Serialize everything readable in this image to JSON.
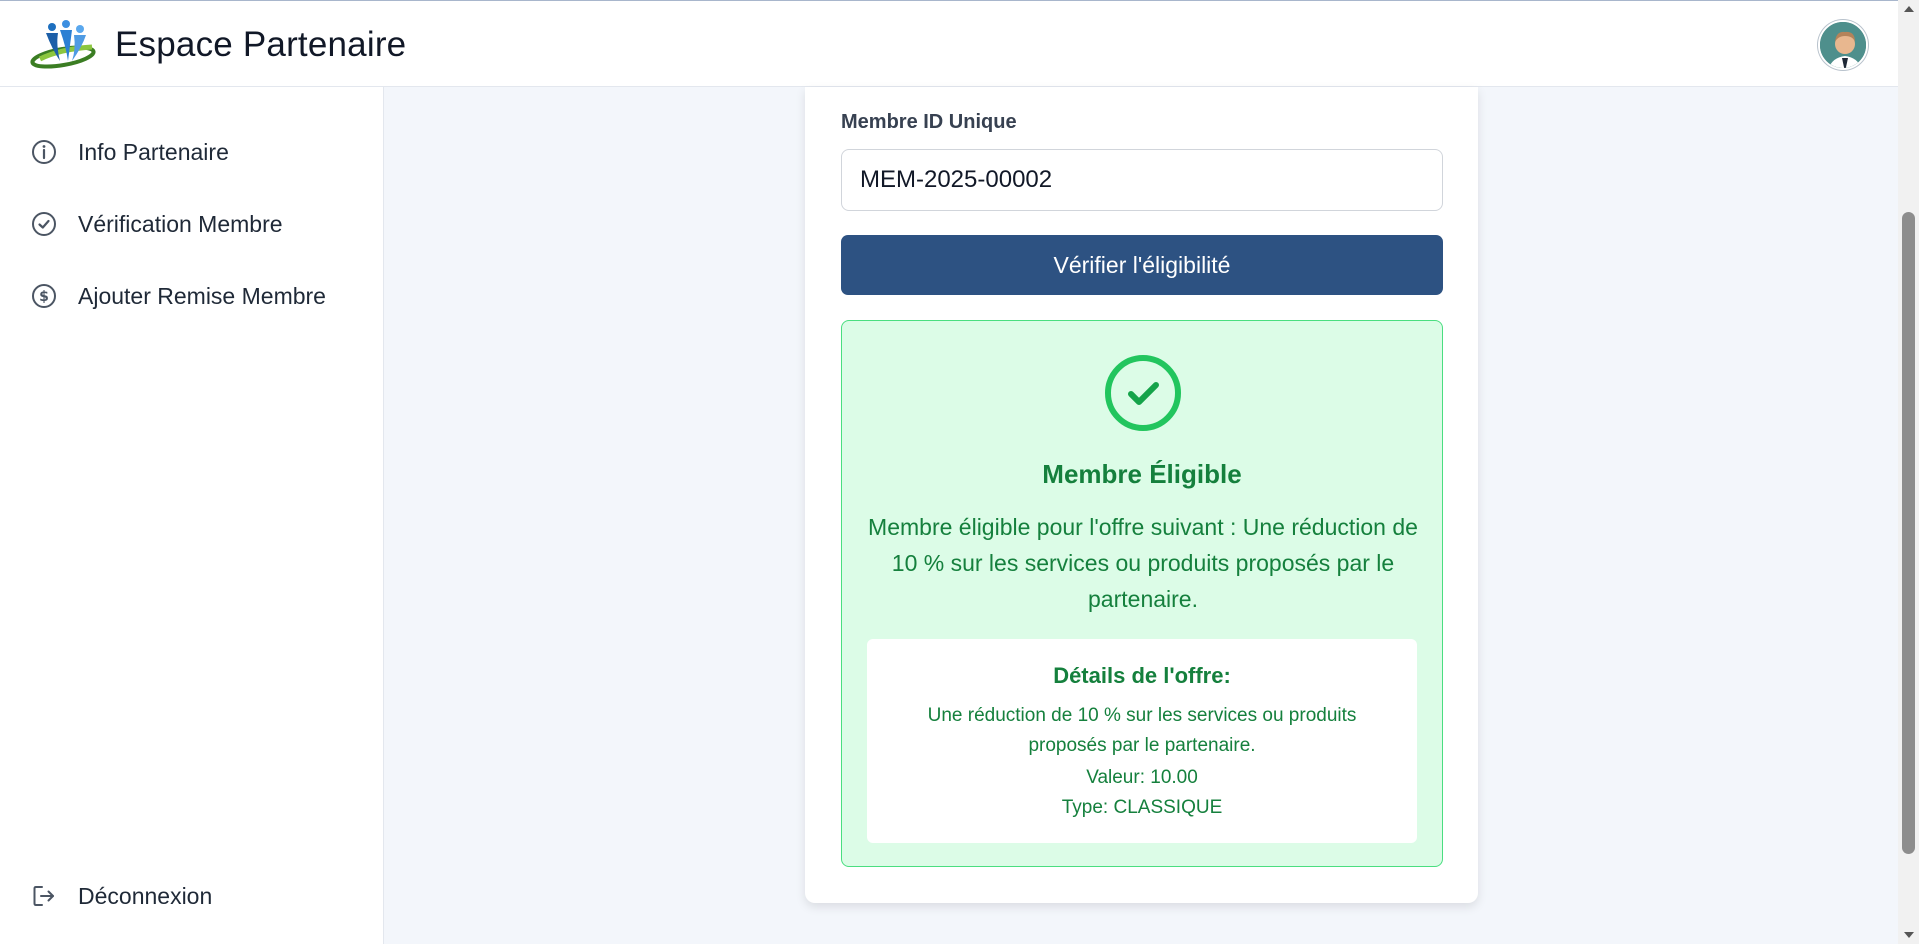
{
  "header": {
    "title": "Espace Partenaire",
    "logo_icon": "people-swoosh-logo",
    "avatar_icon": "user-avatar"
  },
  "sidebar": {
    "items": [
      {
        "label": "Info Partenaire",
        "icon": "info-icon"
      },
      {
        "label": "Vérification Membre",
        "icon": "check-circle-icon"
      },
      {
        "label": "Ajouter Remise Membre",
        "icon": "dollar-circle-icon"
      }
    ],
    "logout": {
      "label": "Déconnexion",
      "icon": "logout-icon"
    }
  },
  "form": {
    "field_label": "Membre ID Unique",
    "field_value": "MEM-2025-00002",
    "button_label": "Vérifier l'éligibilité"
  },
  "result": {
    "title": "Membre Éligible",
    "description": "Membre éligible pour l'offre suivant : Une réduction de 10 % sur les services ou produits proposés par le partenaire.",
    "offer": {
      "title": "Détails de l'offre:",
      "description": "Une réduction de 10 % sur les services ou produits proposés par le partenaire.",
      "value": "Valeur: 10.00",
      "type": "Type: CLASSIQUE"
    }
  },
  "colors": {
    "primary": "#2d5282",
    "success_text": "#15803d",
    "success_bg": "#dcfce7",
    "success_border": "#4ade80",
    "success_icon": "#22c55e"
  }
}
